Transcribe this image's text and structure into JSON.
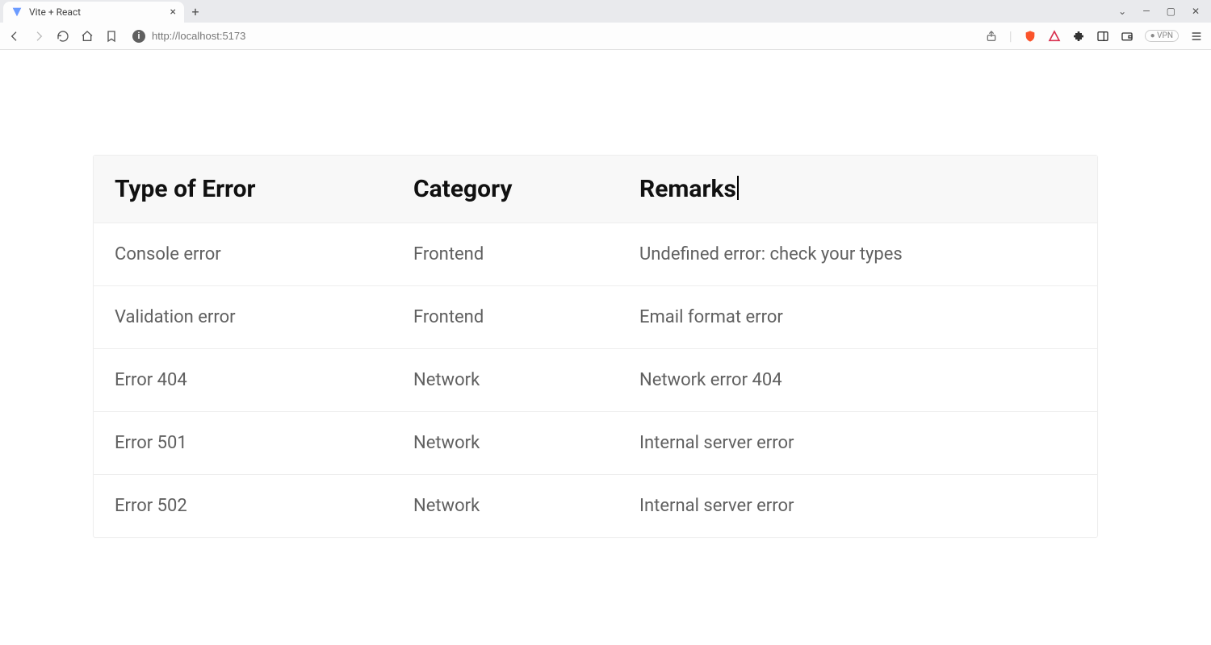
{
  "browser": {
    "tab_title": "Vite + React",
    "url": "http://localhost:5173",
    "vpn_label": "● VPN"
  },
  "table": {
    "headers": [
      "Type of Error",
      "Category",
      "Remarks"
    ],
    "rows": [
      {
        "type": "Console error",
        "category": "Frontend",
        "remarks": "Undefined error: check your types"
      },
      {
        "type": "Validation error",
        "category": "Frontend",
        "remarks": "Email format error"
      },
      {
        "type": "Error 404",
        "category": "Network",
        "remarks": "Network error 404"
      },
      {
        "type": "Error 501",
        "category": "Network",
        "remarks": "Internal server error"
      },
      {
        "type": "Error 502",
        "category": "Network",
        "remarks": "Internal server error"
      }
    ]
  }
}
